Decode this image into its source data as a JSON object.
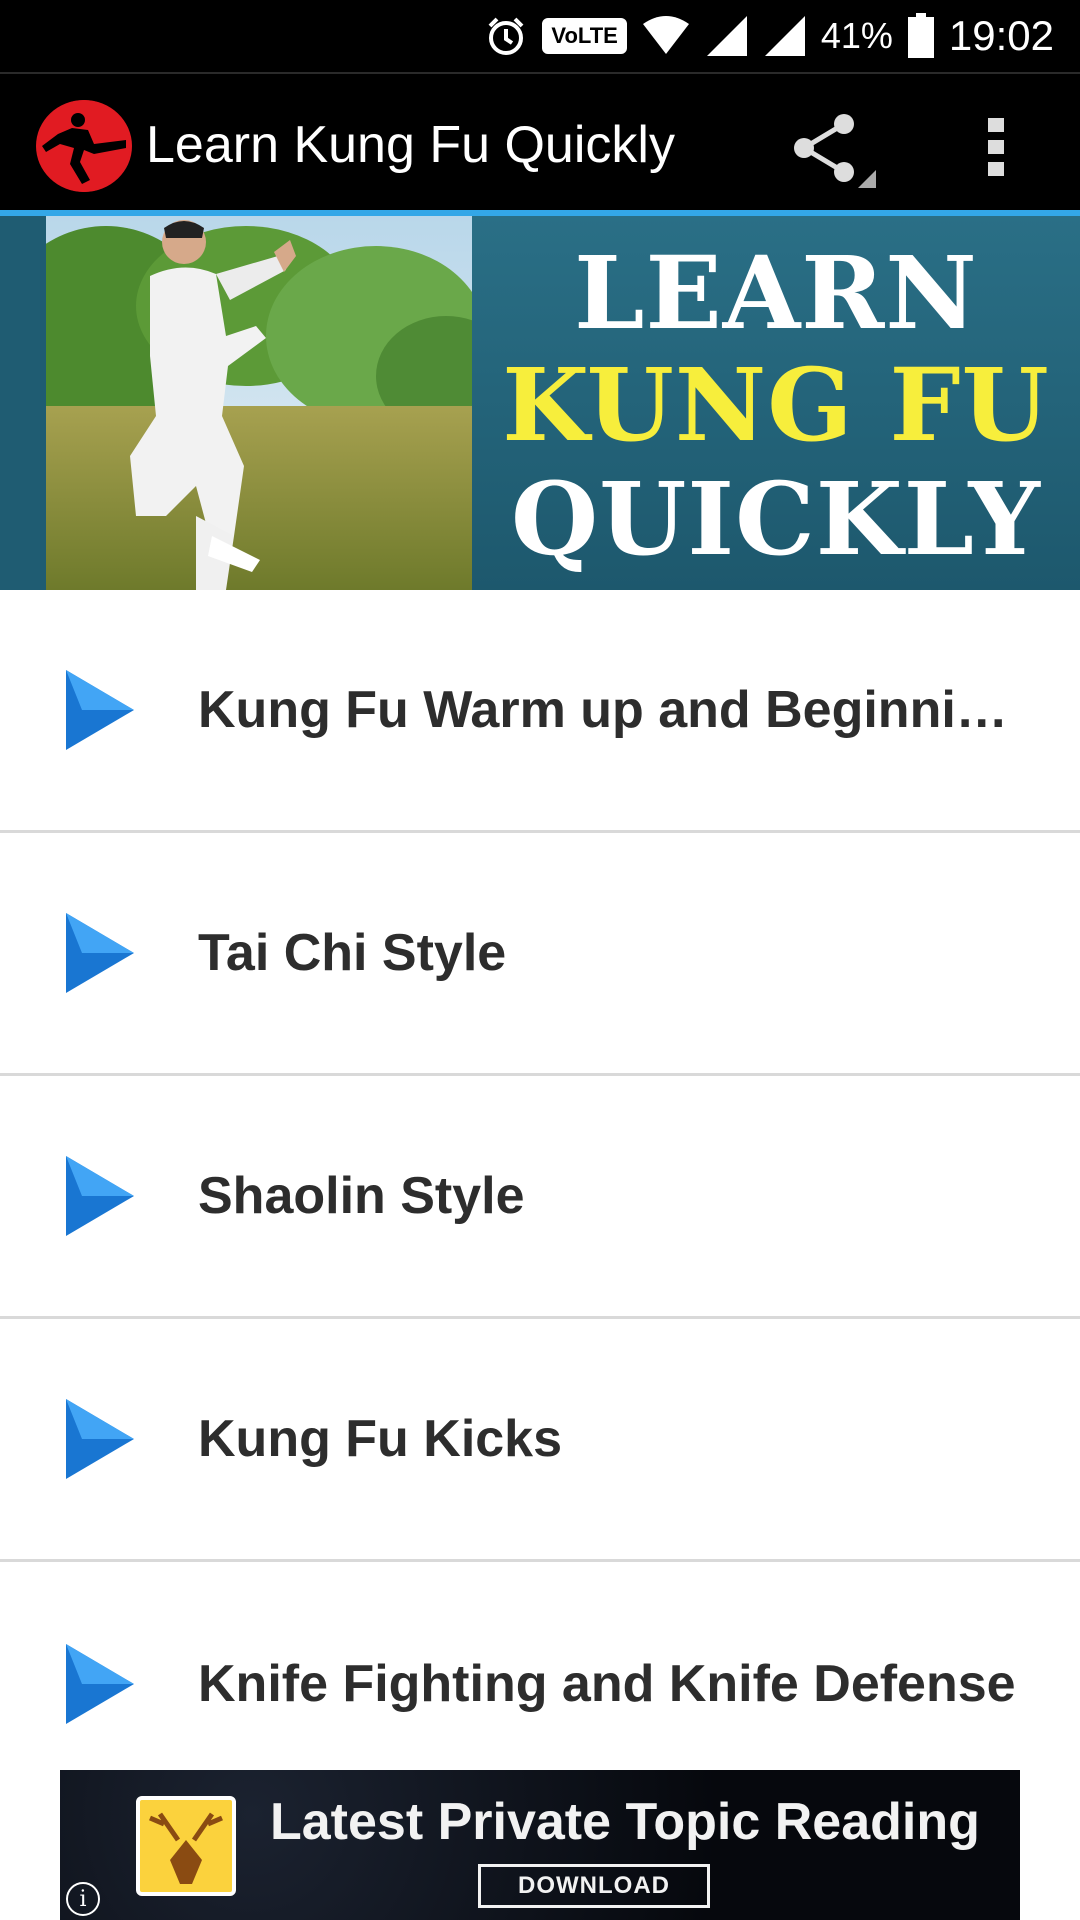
{
  "status_bar": {
    "icons": [
      "alarm-icon",
      "volte-icon",
      "wifi-icon",
      "signal-icon",
      "signal-icon",
      "battery-icon"
    ],
    "volte_label": "VoLTE",
    "battery_percent": "41%",
    "time": "19:02"
  },
  "app_bar": {
    "title": "Learn Kung Fu Quickly",
    "share_icon": "share-icon",
    "overflow_icon": "more-vert-icon"
  },
  "banner": {
    "line1": "LEARN",
    "line2": "KUNG FU",
    "line3": "QUICKLY",
    "colors": {
      "panel": "#1f5c72",
      "highlight": "#f7ee3c",
      "text": "#ffffff"
    }
  },
  "menu": {
    "items": [
      {
        "label": "Kung Fu Warm up and Beginning Training",
        "icon": "play-arrow-icon"
      },
      {
        "label": "Tai Chi Style",
        "icon": "play-arrow-icon"
      },
      {
        "label": "Shaolin Style",
        "icon": "play-arrow-icon"
      },
      {
        "label": "Kung Fu Kicks",
        "icon": "play-arrow-icon"
      },
      {
        "label": "Knife Fighting and Knife Defense",
        "icon": "play-arrow-icon"
      }
    ]
  },
  "ad": {
    "title": "Latest Private Topic Reading",
    "button": "DOWNLOAD",
    "info": "i"
  },
  "colors": {
    "accent": "#33a7e8",
    "app_bar": "#000000",
    "play_icon": "#1e88e5",
    "divider": "#d9d9d9"
  }
}
